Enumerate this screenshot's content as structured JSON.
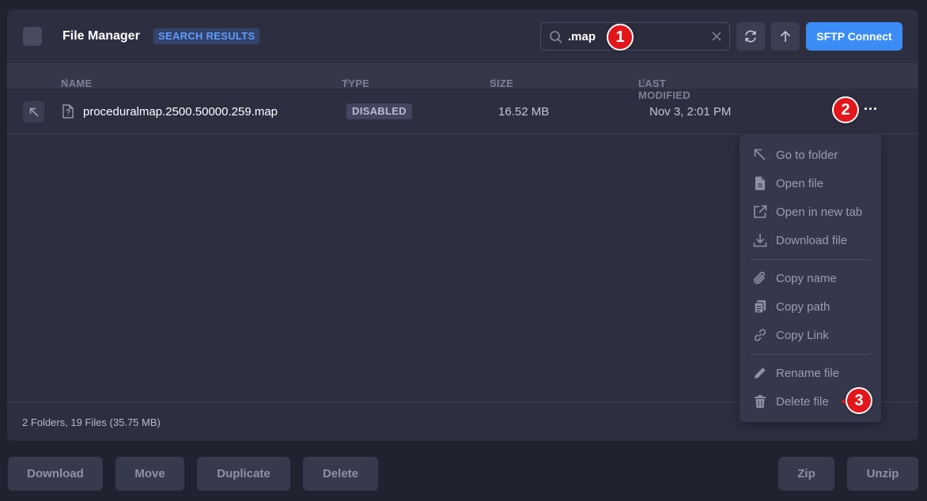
{
  "header": {
    "title": "File Manager",
    "badge": "SEARCH RESULTS",
    "search_value": ".map",
    "search_placeholder": "",
    "sftp_label": "SFTP Connect"
  },
  "columns": {
    "name": "NAME",
    "type": "TYPE",
    "size": "SIZE",
    "modified": "LAST MODIFIED"
  },
  "rows": [
    {
      "name": "proceduralmap.2500.50000.259.map",
      "type": "DISABLED",
      "size": "16.52 MB",
      "modified": "Nov 3, 2:01 PM",
      "more": "···"
    }
  ],
  "status": "2 Folders, 19 Files (35.75 MB)",
  "context_menu": {
    "items": [
      {
        "label": "Go to folder",
        "icon": "arrow-up-left-icon"
      },
      {
        "label": "Open file",
        "icon": "file-icon"
      },
      {
        "label": "Open in new tab",
        "icon": "external-link-icon"
      },
      {
        "label": "Download file",
        "icon": "download-icon"
      },
      {
        "label": "Copy name",
        "icon": "paperclip-icon"
      },
      {
        "label": "Copy path",
        "icon": "clipboard-icon"
      },
      {
        "label": "Copy Link",
        "icon": "link-icon"
      },
      {
        "label": "Rename file",
        "icon": "pencil-icon"
      },
      {
        "label": "Delete file",
        "icon": "trash-icon"
      }
    ]
  },
  "markers": [
    "1",
    "2",
    "3"
  ],
  "actions": {
    "download": "Download",
    "move": "Move",
    "duplicate": "Duplicate",
    "delete": "Delete",
    "zip": "Zip",
    "unzip": "Unzip"
  },
  "colors": {
    "background": "#21222f",
    "panel": "#2d2f40",
    "accent": "#3c8cf6",
    "marker": "#e3171b"
  }
}
